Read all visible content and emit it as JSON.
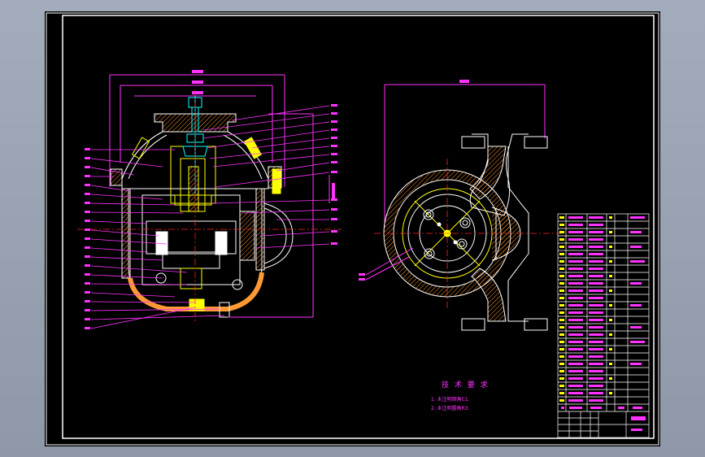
{
  "drawing": {
    "tech_requirements_title": "技 术 要 求",
    "notes": [
      "1. 未注明倒角C1.",
      "2. 未注明圆角R3."
    ],
    "colors": {
      "background": "#000000",
      "outline": "#ffffff",
      "dimension": "#ff33ff",
      "centerline": "#ff2020",
      "part": "#ffff00",
      "detail": "#00ffff",
      "hatch": "#ff9933"
    }
  }
}
